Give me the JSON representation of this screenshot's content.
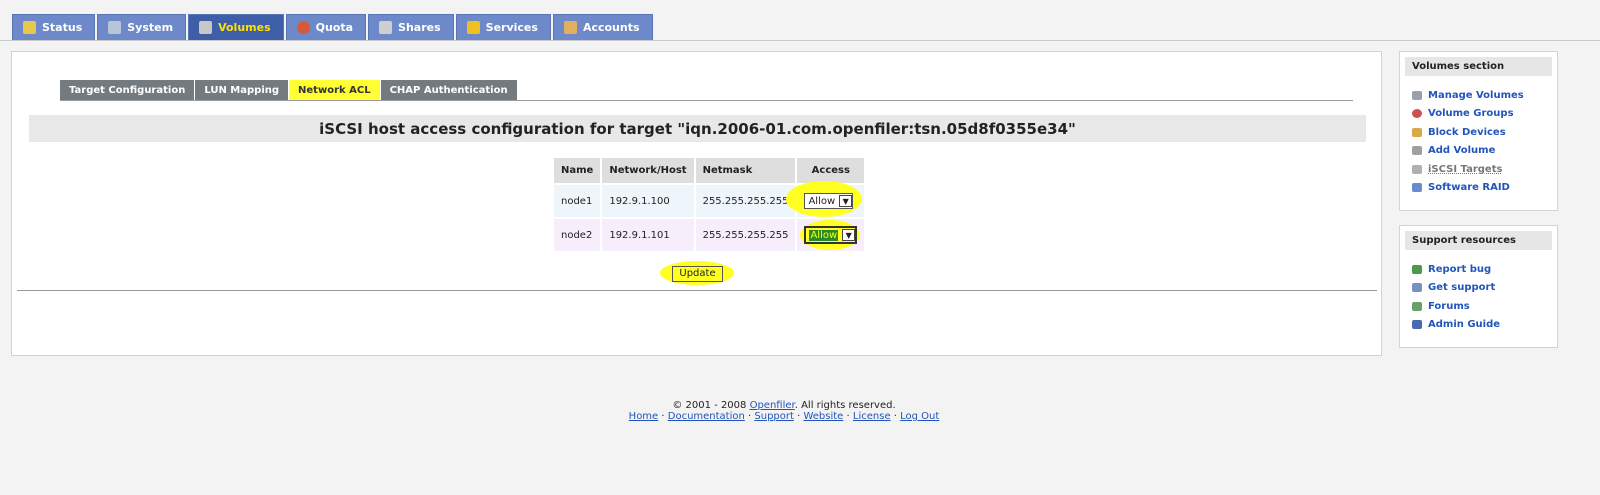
{
  "topnav": {
    "tabs": [
      {
        "label": "Status",
        "icon": "status-icon",
        "color": "#e8c84a"
      },
      {
        "label": "System",
        "icon": "system-icon",
        "color": "#b8c4d8"
      },
      {
        "label": "Volumes",
        "icon": "volumes-icon",
        "color": "#c8c8c8"
      },
      {
        "label": "Quota",
        "icon": "quota-icon",
        "color": "#d55a3a"
      },
      {
        "label": "Shares",
        "icon": "shares-icon",
        "color": "#cfcfcf"
      },
      {
        "label": "Services",
        "icon": "services-icon",
        "color": "#f0c020"
      },
      {
        "label": "Accounts",
        "icon": "accounts-icon",
        "color": "#e0b060"
      }
    ],
    "active": "Volumes"
  },
  "subnav": {
    "tabs": [
      "Target Configuration",
      "LUN Mapping",
      "Network ACL",
      "CHAP Authentication"
    ],
    "active": "Network ACL"
  },
  "title": "iSCSI host access configuration for target \"iqn.2006-01.com.openfiler:tsn.05d8f0355e34\"",
  "acl_table": {
    "headers": [
      "Name",
      "Network/Host",
      "Netmask",
      "Access"
    ],
    "rows": [
      {
        "name": "node1",
        "host": "192.9.1.100",
        "netmask": "255.255.255.255",
        "access": "Allow"
      },
      {
        "name": "node2",
        "host": "192.9.1.101",
        "netmask": "255.255.255.255",
        "access": "Allow"
      }
    ]
  },
  "update_label": "Update",
  "sidebar": {
    "volumes": {
      "heading": "Volumes section",
      "items": [
        {
          "label": "Manage Volumes",
          "icon": "disk-icon"
        },
        {
          "label": "Volume Groups",
          "icon": "groups-icon"
        },
        {
          "label": "Block Devices",
          "icon": "block-icon"
        },
        {
          "label": "Add Volume",
          "icon": "add-volume-icon"
        },
        {
          "label": "iSCSI Targets",
          "icon": "iscsi-icon"
        },
        {
          "label": "Software RAID",
          "icon": "raid-icon"
        }
      ]
    },
    "support": {
      "heading": "Support resources",
      "items": [
        {
          "label": "Report bug",
          "icon": "bug-icon"
        },
        {
          "label": "Get support",
          "icon": "support-icon"
        },
        {
          "label": "Forums",
          "icon": "forums-icon"
        },
        {
          "label": "Admin Guide",
          "icon": "guide-icon"
        }
      ]
    }
  },
  "footer": {
    "copyright_prefix": "© 2001 - 2008 ",
    "brand": "Openfiler",
    "copyright_suffix": ". All rights reserved.",
    "links": [
      "Home",
      "Documentation",
      "Support",
      "Website",
      "License",
      "Log Out"
    ]
  }
}
